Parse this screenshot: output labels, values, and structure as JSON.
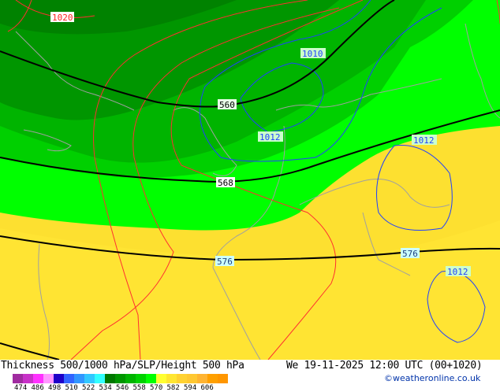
{
  "map": {
    "pressure_labels_red": [
      "1020"
    ],
    "pressure_labels_blue": [
      "1010",
      "1012",
      "1012",
      "1012"
    ],
    "thickness_labels": [
      "560",
      "568",
      "576"
    ]
  },
  "footer": {
    "title": "Thickness 500/1000 hPa/SLP/Height 500 hPa",
    "datetime": "We 19-11-2025 12:00 UTC (00+1020)",
    "credit": "©weatheronline.co.uk",
    "legend_ticks": [
      "474",
      "486",
      "498",
      "510",
      "522",
      "534",
      "546",
      "558",
      "570",
      "582",
      "594",
      "606"
    ],
    "legend_colors": [
      "#a02ca0",
      "#c832c8",
      "#ff32ff",
      "#ff96ff",
      "#1e00c8",
      "#3264ff",
      "#3296ff",
      "#32c8ff",
      "#32ffff",
      "#007800",
      "#009600",
      "#00b400",
      "#00d200",
      "#00ff00",
      "#ffff32",
      "#ffe632",
      "#ffd232",
      "#ffc832",
      "#ffb432",
      "#ffa000",
      "#ff9600"
    ]
  }
}
